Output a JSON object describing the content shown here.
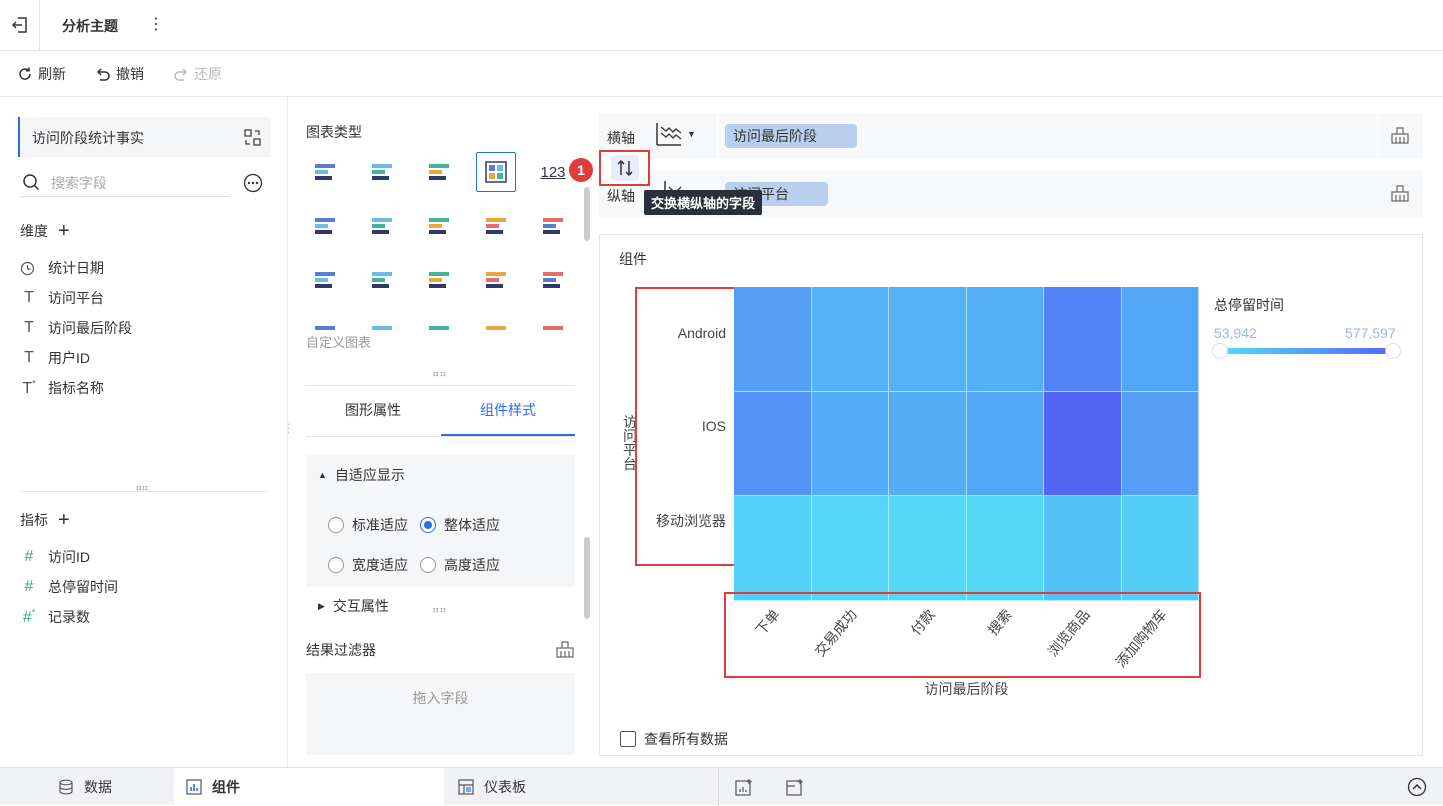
{
  "topbar": {
    "title": "分析主题"
  },
  "toolbar": {
    "refresh": "刷新",
    "undo": "撤销",
    "redo": "还原"
  },
  "left": {
    "dataset": "访问阶段统计事实",
    "search_placeholder": "搜索字段",
    "dimensions_label": "维度",
    "dimensions": [
      {
        "label": "统计日期",
        "icon": "clock-icon"
      },
      {
        "label": "访问平台",
        "icon": "text-type-icon"
      },
      {
        "label": "访问最后阶段",
        "icon": "text-type-icon"
      },
      {
        "label": "用户ID",
        "icon": "text-type-icon"
      },
      {
        "label": "指标名称",
        "icon": "text-calc-icon"
      }
    ],
    "measures_label": "指标",
    "measures": [
      {
        "label": "访问ID",
        "icon": "hash-icon"
      },
      {
        "label": "总停留时间",
        "icon": "hash-icon"
      },
      {
        "label": "记录数",
        "icon": "hash-calc-icon"
      }
    ]
  },
  "middle": {
    "chart_types_title": "图表类型",
    "custom_chart": "自定义图表",
    "tabs": [
      "图形属性",
      "组件样式"
    ],
    "adaptive_label": "自适应显示",
    "adaptive_options": [
      "标准适应",
      "整体适应",
      "宽度适应",
      "高度适应"
    ],
    "adaptive_selected": "整体适应",
    "interaction_label": "交互属性",
    "filter_label": "结果过滤器",
    "drop_hint": "拖入字段"
  },
  "right": {
    "x_axis_label": "横轴",
    "y_axis_label": "纵轴",
    "x_field": "访问最后阶段",
    "y_field": "访问平台",
    "tooltip": "交换横纵轴的字段",
    "badge": "1",
    "component_title": "组件",
    "view_all": "查看所有数据"
  },
  "chart_data": {
    "type": "heatmap",
    "xlabel": "访问最后阶段",
    "ylabel": "访问平台",
    "x": [
      "下单",
      "交易成功",
      "付款",
      "搜索",
      "浏览商品",
      "添加购物车"
    ],
    "y": [
      "Android",
      "IOS",
      "移动浏览器"
    ],
    "legend_title": "总停留时间",
    "range": [
      53942,
      577597
    ],
    "range_labels": [
      "53,942",
      "577,597"
    ],
    "values": [
      [
        330000,
        240000,
        240000,
        250000,
        450000,
        300000
      ],
      [
        380000,
        270000,
        260000,
        300000,
        577597,
        330000
      ],
      [
        110000,
        90000,
        70000,
        80000,
        170000,
        120000
      ]
    ],
    "colors": {
      "low": "#52ddf7",
      "high": "#5566f5"
    }
  },
  "bottom": {
    "tabs": [
      "数据",
      "组件",
      "仪表板"
    ],
    "active": "组件"
  }
}
